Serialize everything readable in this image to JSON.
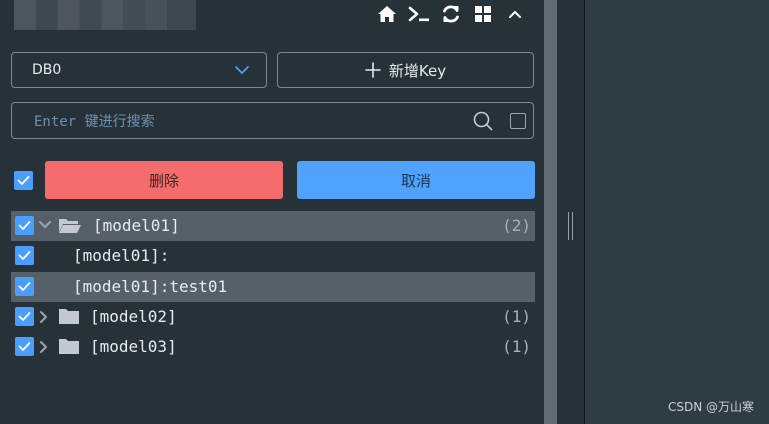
{
  "toolbar": {
    "icons": [
      "home-icon",
      "terminal-icon",
      "refresh-icon",
      "grid-icon",
      "collapse-icon"
    ]
  },
  "db_select": {
    "value": "DB0"
  },
  "new_key_button": {
    "label": "新增Key"
  },
  "search": {
    "placeholder": "Enter 键进行搜索",
    "value": ""
  },
  "actions": {
    "delete_label": "删除",
    "cancel_label": "取消"
  },
  "tree": [
    {
      "label": "[model01]",
      "count": "(2)",
      "expanded": true,
      "checked": true
    },
    {
      "label": "[model01]:",
      "checked": true
    },
    {
      "label": "[model01]:test01",
      "checked": true
    },
    {
      "label": "[model02]",
      "count": "(1)",
      "expanded": false,
      "checked": true
    },
    {
      "label": "[model03]",
      "count": "(1)",
      "expanded": false,
      "checked": true
    }
  ],
  "watermark": "CSDN @万山寒",
  "colors": {
    "background": "#263238",
    "delete": "#f56c6c",
    "primary": "#4fa3ff",
    "checkbox": "#4a9eff",
    "highlight_row": "#556068"
  }
}
